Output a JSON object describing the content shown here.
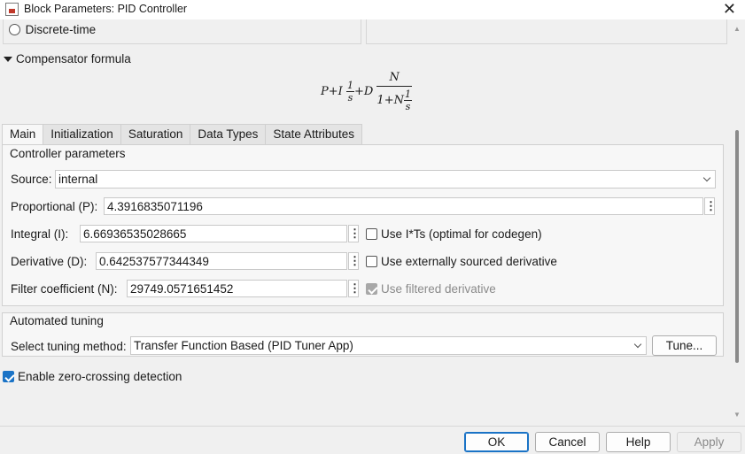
{
  "window": {
    "title": "Block Parameters: PID Controller"
  },
  "time_domain": {
    "discrete_label": "Discrete-time"
  },
  "compensator": {
    "header": "Compensator formula"
  },
  "tabs": [
    {
      "label": "Main"
    },
    {
      "label": "Initialization"
    },
    {
      "label": "Saturation"
    },
    {
      "label": "Data Types"
    },
    {
      "label": "State Attributes"
    }
  ],
  "main": {
    "group_title": "Controller parameters",
    "source_label": "Source:",
    "source_value": "internal",
    "p_label": "Proportional (P):",
    "p_value": "4.3916835071196",
    "i_label": "Integral (I):",
    "i_value": "6.66936535028665",
    "use_its_label": "Use I*Ts (optimal for codegen)",
    "use_its_checked": false,
    "d_label": "Derivative (D):",
    "d_value": "0.642537577344349",
    "ext_deriv_label": "Use externally sourced derivative",
    "ext_deriv_checked": false,
    "n_label": "Filter coefficient (N):",
    "n_value": "29749.0571651452",
    "filtered_label": "Use filtered derivative",
    "filtered_checked": true
  },
  "tuning": {
    "group_title": "Automated tuning",
    "method_label": "Select tuning method:",
    "method_value": "Transfer Function Based (PID Tuner App)",
    "tune_button": "Tune..."
  },
  "zero_crossing": {
    "label": "Enable zero-crossing detection",
    "checked": true
  },
  "footer": {
    "ok": "OK",
    "cancel": "Cancel",
    "help": "Help",
    "apply": "Apply"
  },
  "colors": {
    "accent": "#1a73c6",
    "disabled": "#8a8a8a"
  }
}
